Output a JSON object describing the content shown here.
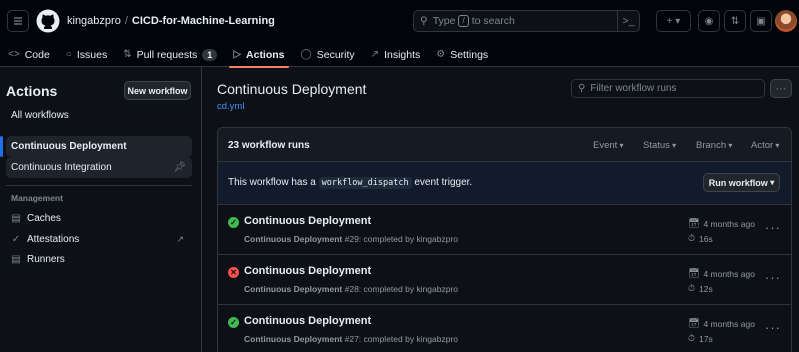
{
  "header": {
    "owner": "kingabzpro",
    "separator": "/",
    "repo": "CICD-for-Machine-Learning",
    "search_placeholder_prefix": "Type",
    "search_key": "/",
    "search_placeholder_suffix": "to search"
  },
  "tabs": [
    {
      "label": "Code",
      "icon": "code-icon"
    },
    {
      "label": "Issues",
      "icon": "issue-icon"
    },
    {
      "label": "Pull requests",
      "icon": "pull-request-icon",
      "count": "1"
    },
    {
      "label": "Actions",
      "icon": "play-icon",
      "active": true
    },
    {
      "label": "Security",
      "icon": "shield-icon"
    },
    {
      "label": "Insights",
      "icon": "graph-icon"
    },
    {
      "label": "Settings",
      "icon": "gear-icon"
    }
  ],
  "sidebar": {
    "title": "Actions",
    "new_workflow_label": "New workflow",
    "items": [
      {
        "label": "All workflows"
      },
      {
        "label": "Continuous Deployment",
        "selected": true
      },
      {
        "label": "Continuous Integration",
        "pinned": true
      }
    ],
    "management_label": "Management",
    "management_items": [
      {
        "label": "Caches",
        "icon": "cache-icon"
      },
      {
        "label": "Attestations",
        "icon": "attestation-icon",
        "external": "↗"
      },
      {
        "label": "Runners",
        "icon": "server-icon"
      }
    ]
  },
  "main": {
    "title": "Continuous Deployment",
    "file": "cd.yml",
    "filter_placeholder": "Filter workflow runs",
    "runs_count": "23 workflow runs",
    "filters": [
      "Event",
      "Status",
      "Branch",
      "Actor"
    ],
    "dispatch_prefix": "This workflow has a",
    "dispatch_code": "workflow_dispatch",
    "dispatch_suffix": "event trigger.",
    "run_workflow_label": "Run workflow",
    "runs": [
      {
        "title": "Continuous Deployment",
        "workflow": "Continuous Deployment",
        "number": "#29",
        "detail": ": completed by kingabzpro",
        "status": "success",
        "when": "4 months ago",
        "duration": "16s"
      },
      {
        "title": "Continuous Deployment",
        "workflow": "Continuous Deployment",
        "number": "#28",
        "detail": ": completed by kingabzpro",
        "status": "failure",
        "when": "4 months ago",
        "duration": "12s"
      },
      {
        "title": "Continuous Deployment",
        "workflow": "Continuous Deployment",
        "number": "#27",
        "detail": ": completed by kingabzpro",
        "status": "success",
        "when": "4 months ago",
        "duration": "17s"
      }
    ]
  },
  "colors": {
    "background": "#0d1117",
    "accent": "#f78166",
    "link": "#4493f8",
    "success": "#3fb950",
    "failure": "#f85149"
  }
}
